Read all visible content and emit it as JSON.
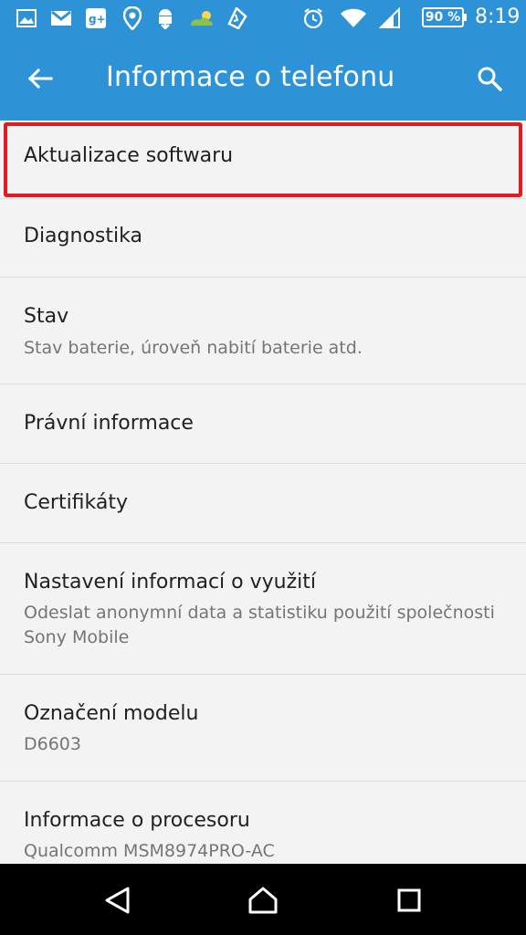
{
  "status_bar": {
    "notification_icons": [
      "gallery-icon",
      "gmail-icon",
      "google-plus-icon",
      "location-pin-icon",
      "android-download-icon",
      "weather-icon",
      "phone-cleaner-icon"
    ],
    "system_icons": [
      "alarm-icon",
      "wifi-icon",
      "signal-icon"
    ],
    "battery": "90 %",
    "time": "8:19"
  },
  "app_bar": {
    "title": "Informace o telefonu"
  },
  "list": {
    "items": [
      {
        "title": "Aktualizace softwaru",
        "subtitle": ""
      },
      {
        "title": "Diagnostika",
        "subtitle": ""
      },
      {
        "title": "Stav",
        "subtitle": "Stav baterie, úroveň nabití baterie atd."
      },
      {
        "title": "Právní informace",
        "subtitle": ""
      },
      {
        "title": "Certifikáty",
        "subtitle": ""
      },
      {
        "title": "Nastavení informací o využití",
        "subtitle": "Odeslat anonymní data a statistiku použití společnosti Sony Mobile"
      },
      {
        "title": "Označení modelu",
        "subtitle": "D6603"
      },
      {
        "title": "Informace o procesoru",
        "subtitle": "Qualcomm MSM8974PRO-AC"
      }
    ]
  },
  "colors": {
    "accent": "#2d93d6",
    "highlight": "#e21b23",
    "background": "#f3f3f3"
  }
}
